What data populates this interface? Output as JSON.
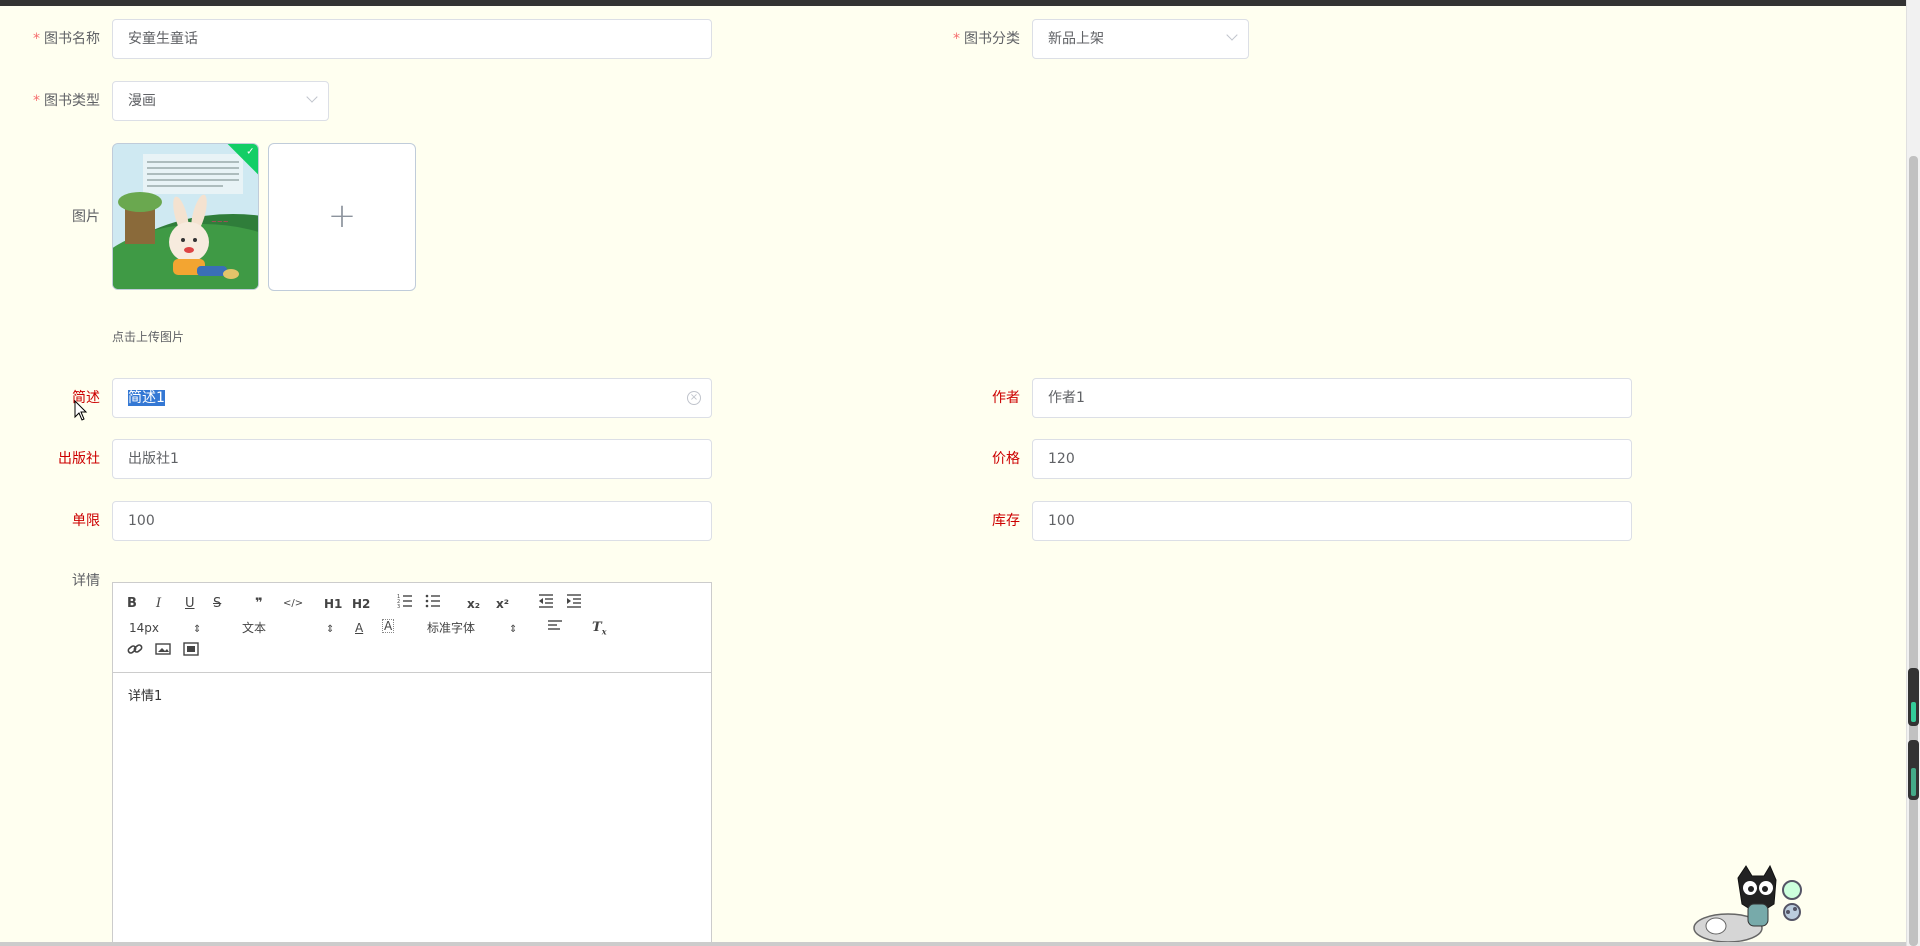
{
  "form": {
    "book_name": {
      "label": "图书名称",
      "value": "安童生童话"
    },
    "book_category": {
      "label": "图书分类",
      "value": "新品上架"
    },
    "book_type": {
      "label": "图书类型",
      "value": "漫画"
    },
    "picture": {
      "label": "图片",
      "tip": "点击上传图片",
      "uploader_glyph": "+"
    },
    "summary": {
      "label": "简述",
      "value": "简述1"
    },
    "author": {
      "label": "作者",
      "value": "作者1"
    },
    "publisher": {
      "label": "出版社",
      "value": "出版社1"
    },
    "price": {
      "label": "价格",
      "value": "120"
    },
    "limit": {
      "label": "单限",
      "value": "100"
    },
    "stock": {
      "label": "库存",
      "value": "100"
    },
    "detail": {
      "label": "详情",
      "content": "详情1"
    }
  },
  "editor": {
    "font_size": "14px",
    "header_select": "文本",
    "font_family": "标准字体",
    "buttons": {
      "bold": "B",
      "italic": "I",
      "underline": "U",
      "strike": "S",
      "blockquote": "❞",
      "code": "</>",
      "h1": "H1",
      "h2": "H2",
      "subscript": "x₂",
      "superscript": "x²"
    }
  },
  "colors": {
    "required": "#f56c6c",
    "label_red": "#cc0000",
    "background": "#fffff0",
    "selection": "#3478d4",
    "success_badge": "#13ce66"
  }
}
